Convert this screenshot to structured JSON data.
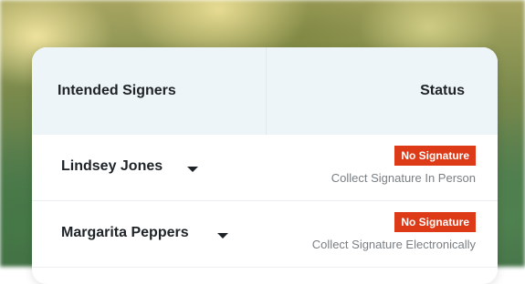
{
  "table": {
    "headers": {
      "signers": "Intended Signers",
      "status": "Status"
    },
    "rows": [
      {
        "name": "Lindsey Jones",
        "status_badge": "No Signature",
        "method": "Collect Signature In Person"
      },
      {
        "name": "Margarita Peppers",
        "status_badge": "No Signature",
        "method": "Collect Signature Electronically"
      }
    ]
  },
  "colors": {
    "badge_bg": "#dd3b17",
    "header_bg": "#eef5f8"
  }
}
